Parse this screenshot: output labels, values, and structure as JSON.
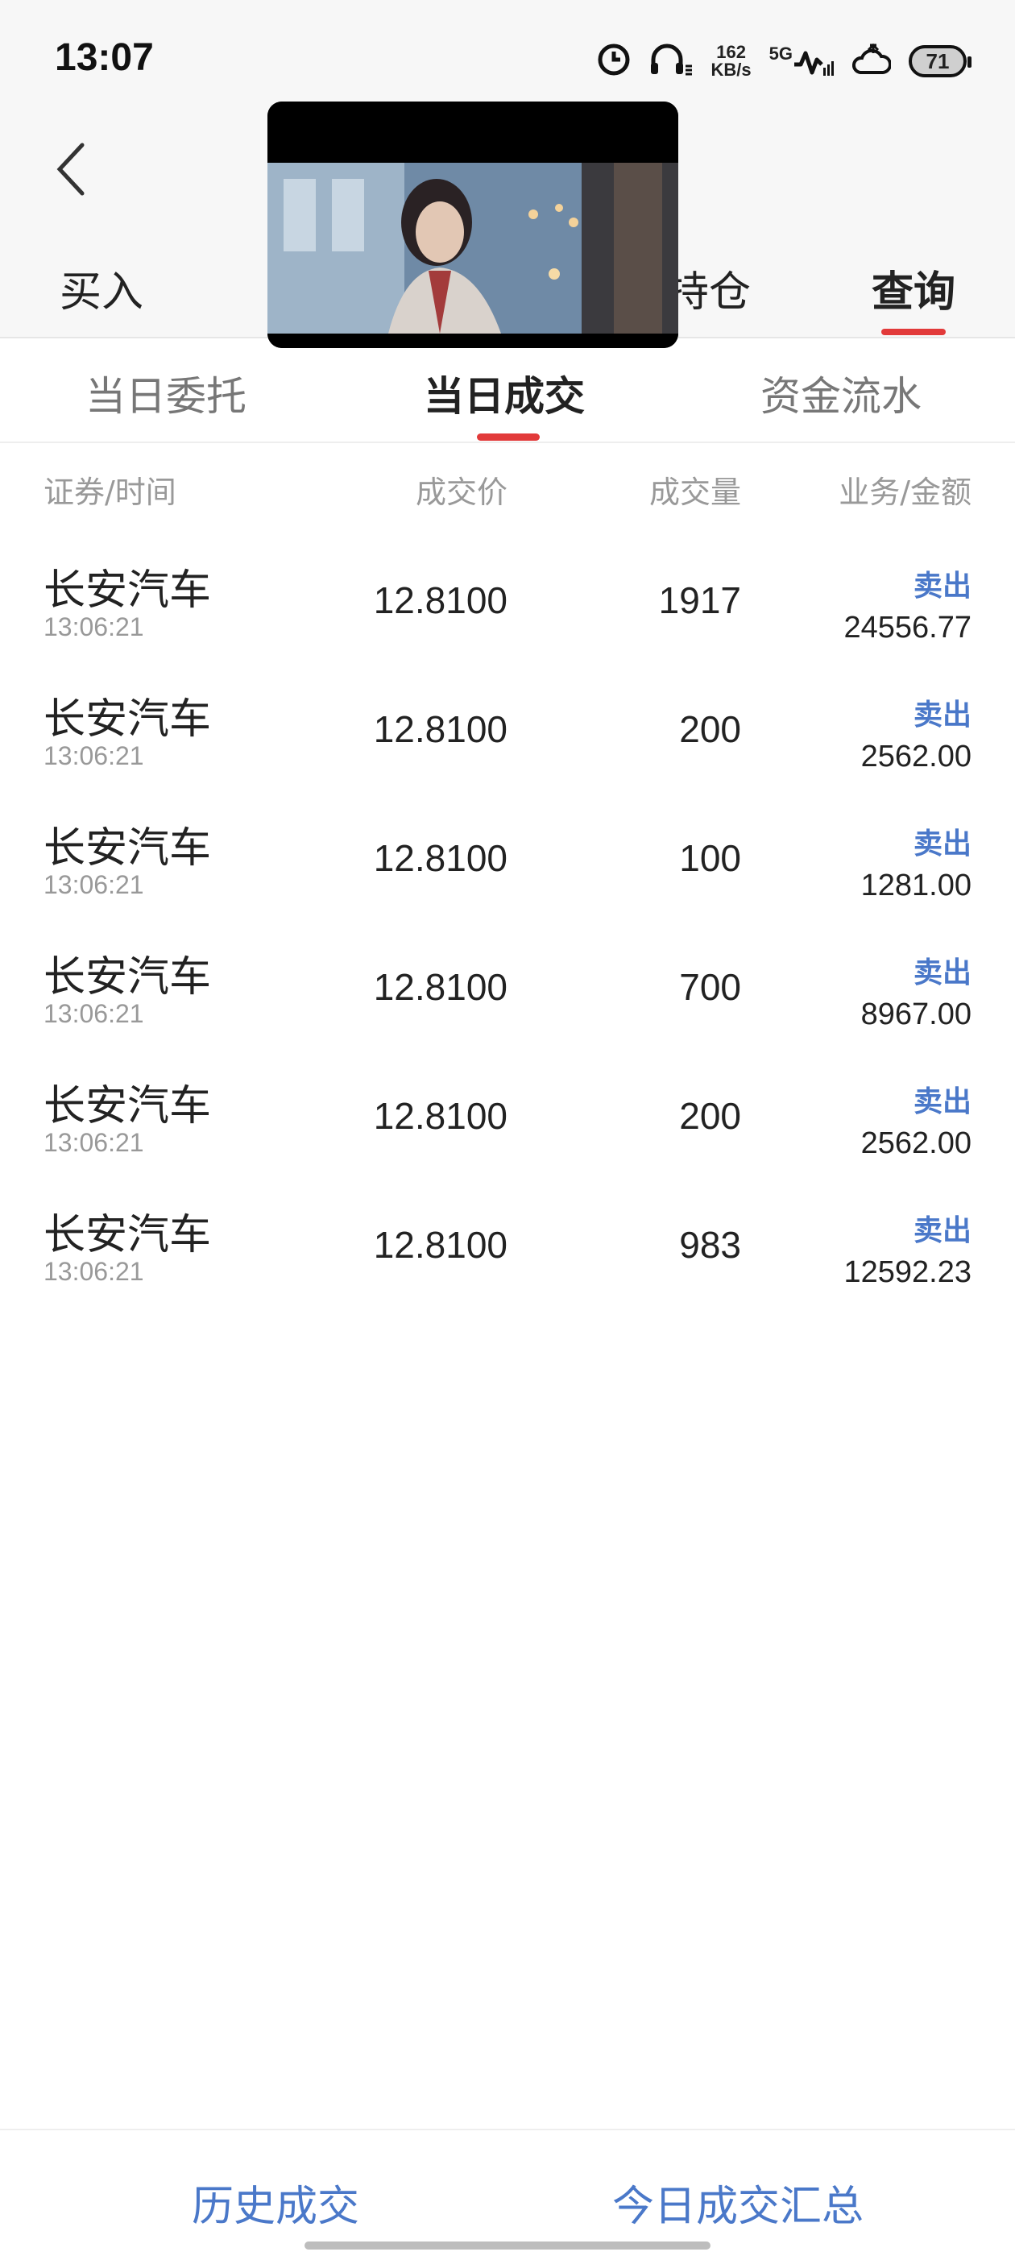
{
  "status_bar": {
    "time": "13:07",
    "net_speed_value": "162",
    "net_speed_unit": "KB/s",
    "signal_label": "5G",
    "battery": "71"
  },
  "main_tabs": [
    {
      "label": "买入"
    },
    {
      "label": "持仓"
    },
    {
      "label": "查询",
      "active": true
    }
  ],
  "sub_tabs": [
    {
      "label": "当日委托"
    },
    {
      "label": "当日成交",
      "active": true
    },
    {
      "label": "资金流水"
    }
  ],
  "table": {
    "headers": [
      "证券/时间",
      "成交价",
      "成交量",
      "业务/金额"
    ],
    "rows": [
      {
        "name": "长安汽车",
        "time": "13:06:21",
        "price": "12.8100",
        "qty": "1917",
        "type": "卖出",
        "amount": "24556.77"
      },
      {
        "name": "长安汽车",
        "time": "13:06:21",
        "price": "12.8100",
        "qty": "200",
        "type": "卖出",
        "amount": "2562.00"
      },
      {
        "name": "长安汽车",
        "time": "13:06:21",
        "price": "12.8100",
        "qty": "100",
        "type": "卖出",
        "amount": "1281.00"
      },
      {
        "name": "长安汽车",
        "time": "13:06:21",
        "price": "12.8100",
        "qty": "700",
        "type": "卖出",
        "amount": "8967.00"
      },
      {
        "name": "长安汽车",
        "time": "13:06:21",
        "price": "12.8100",
        "qty": "200",
        "type": "卖出",
        "amount": "2562.00"
      },
      {
        "name": "长安汽车",
        "time": "13:06:21",
        "price": "12.8100",
        "qty": "983",
        "type": "卖出",
        "amount": "12592.23"
      }
    ]
  },
  "bottom_bar": {
    "history_label": "历史成交",
    "summary_label": "今日成交汇总"
  },
  "colors": {
    "accent_red": "#e23a3a",
    "link_blue": "#4a78c9"
  }
}
